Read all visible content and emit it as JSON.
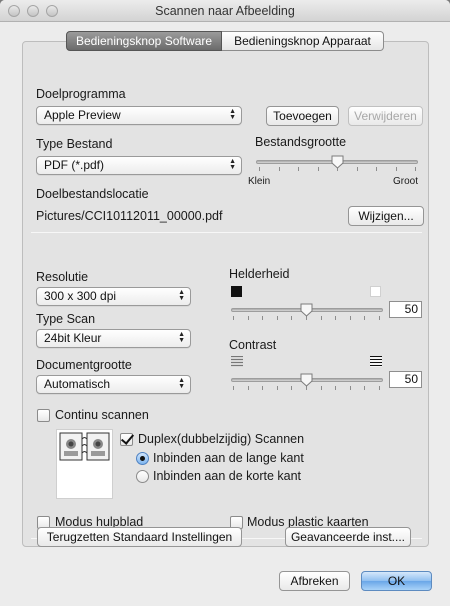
{
  "window": {
    "title": "Scannen naar Afbeelding"
  },
  "tabs": [
    {
      "label": "Bedieningsknop Software",
      "active": true
    },
    {
      "label": "Bedieningsknop Apparaat",
      "active": false
    }
  ],
  "target_app": {
    "label": "Doelprogramma",
    "value": "Apple Preview",
    "add_button": "Toevoegen",
    "remove_button": "Verwijderen"
  },
  "file_type": {
    "label": "Type Bestand",
    "value": "PDF (*.pdf)"
  },
  "file_size": {
    "label": "Bestandsgrootte",
    "min_label": "Klein",
    "max_label": "Groot",
    "level": 0.5
  },
  "destination": {
    "label": "Doelbestandslocatie",
    "path": "Pictures/CCI10112011_00000.pdf",
    "change_button": "Wijzigen..."
  },
  "resolution": {
    "label": "Resolutie",
    "value": "300 x 300 dpi"
  },
  "scan_type": {
    "label": "Type Scan",
    "value": "24bit Kleur"
  },
  "document_size": {
    "label": "Documentgrootte",
    "value": "Automatisch"
  },
  "brightness": {
    "label": "Helderheid",
    "value": "50"
  },
  "contrast": {
    "label": "Contrast",
    "value": "50"
  },
  "continuous_scan": {
    "label": "Continu scannen",
    "checked": false
  },
  "duplex": {
    "label": "Duplex(dubbelzijdig) Scannen",
    "checked": true,
    "options": [
      {
        "label": "Inbinden aan de lange kant",
        "selected": true
      },
      {
        "label": "Inbinden aan de korte kant",
        "selected": false
      }
    ]
  },
  "carrier_sheet": {
    "label": "Modus hulpblad",
    "checked": false
  },
  "plastic_card": {
    "label": "Modus plastic kaarten",
    "checked": false
  },
  "footer": {
    "restore_defaults_button": "Terugzetten Standaard Instellingen",
    "advanced_button": "Geavanceerde inst....",
    "cancel_button": "Afbreken",
    "ok_button": "OK"
  },
  "colors": {
    "accent": "#6aa6e8",
    "window_bg": "#ececec",
    "panel_bg": "#e3e3e3"
  }
}
